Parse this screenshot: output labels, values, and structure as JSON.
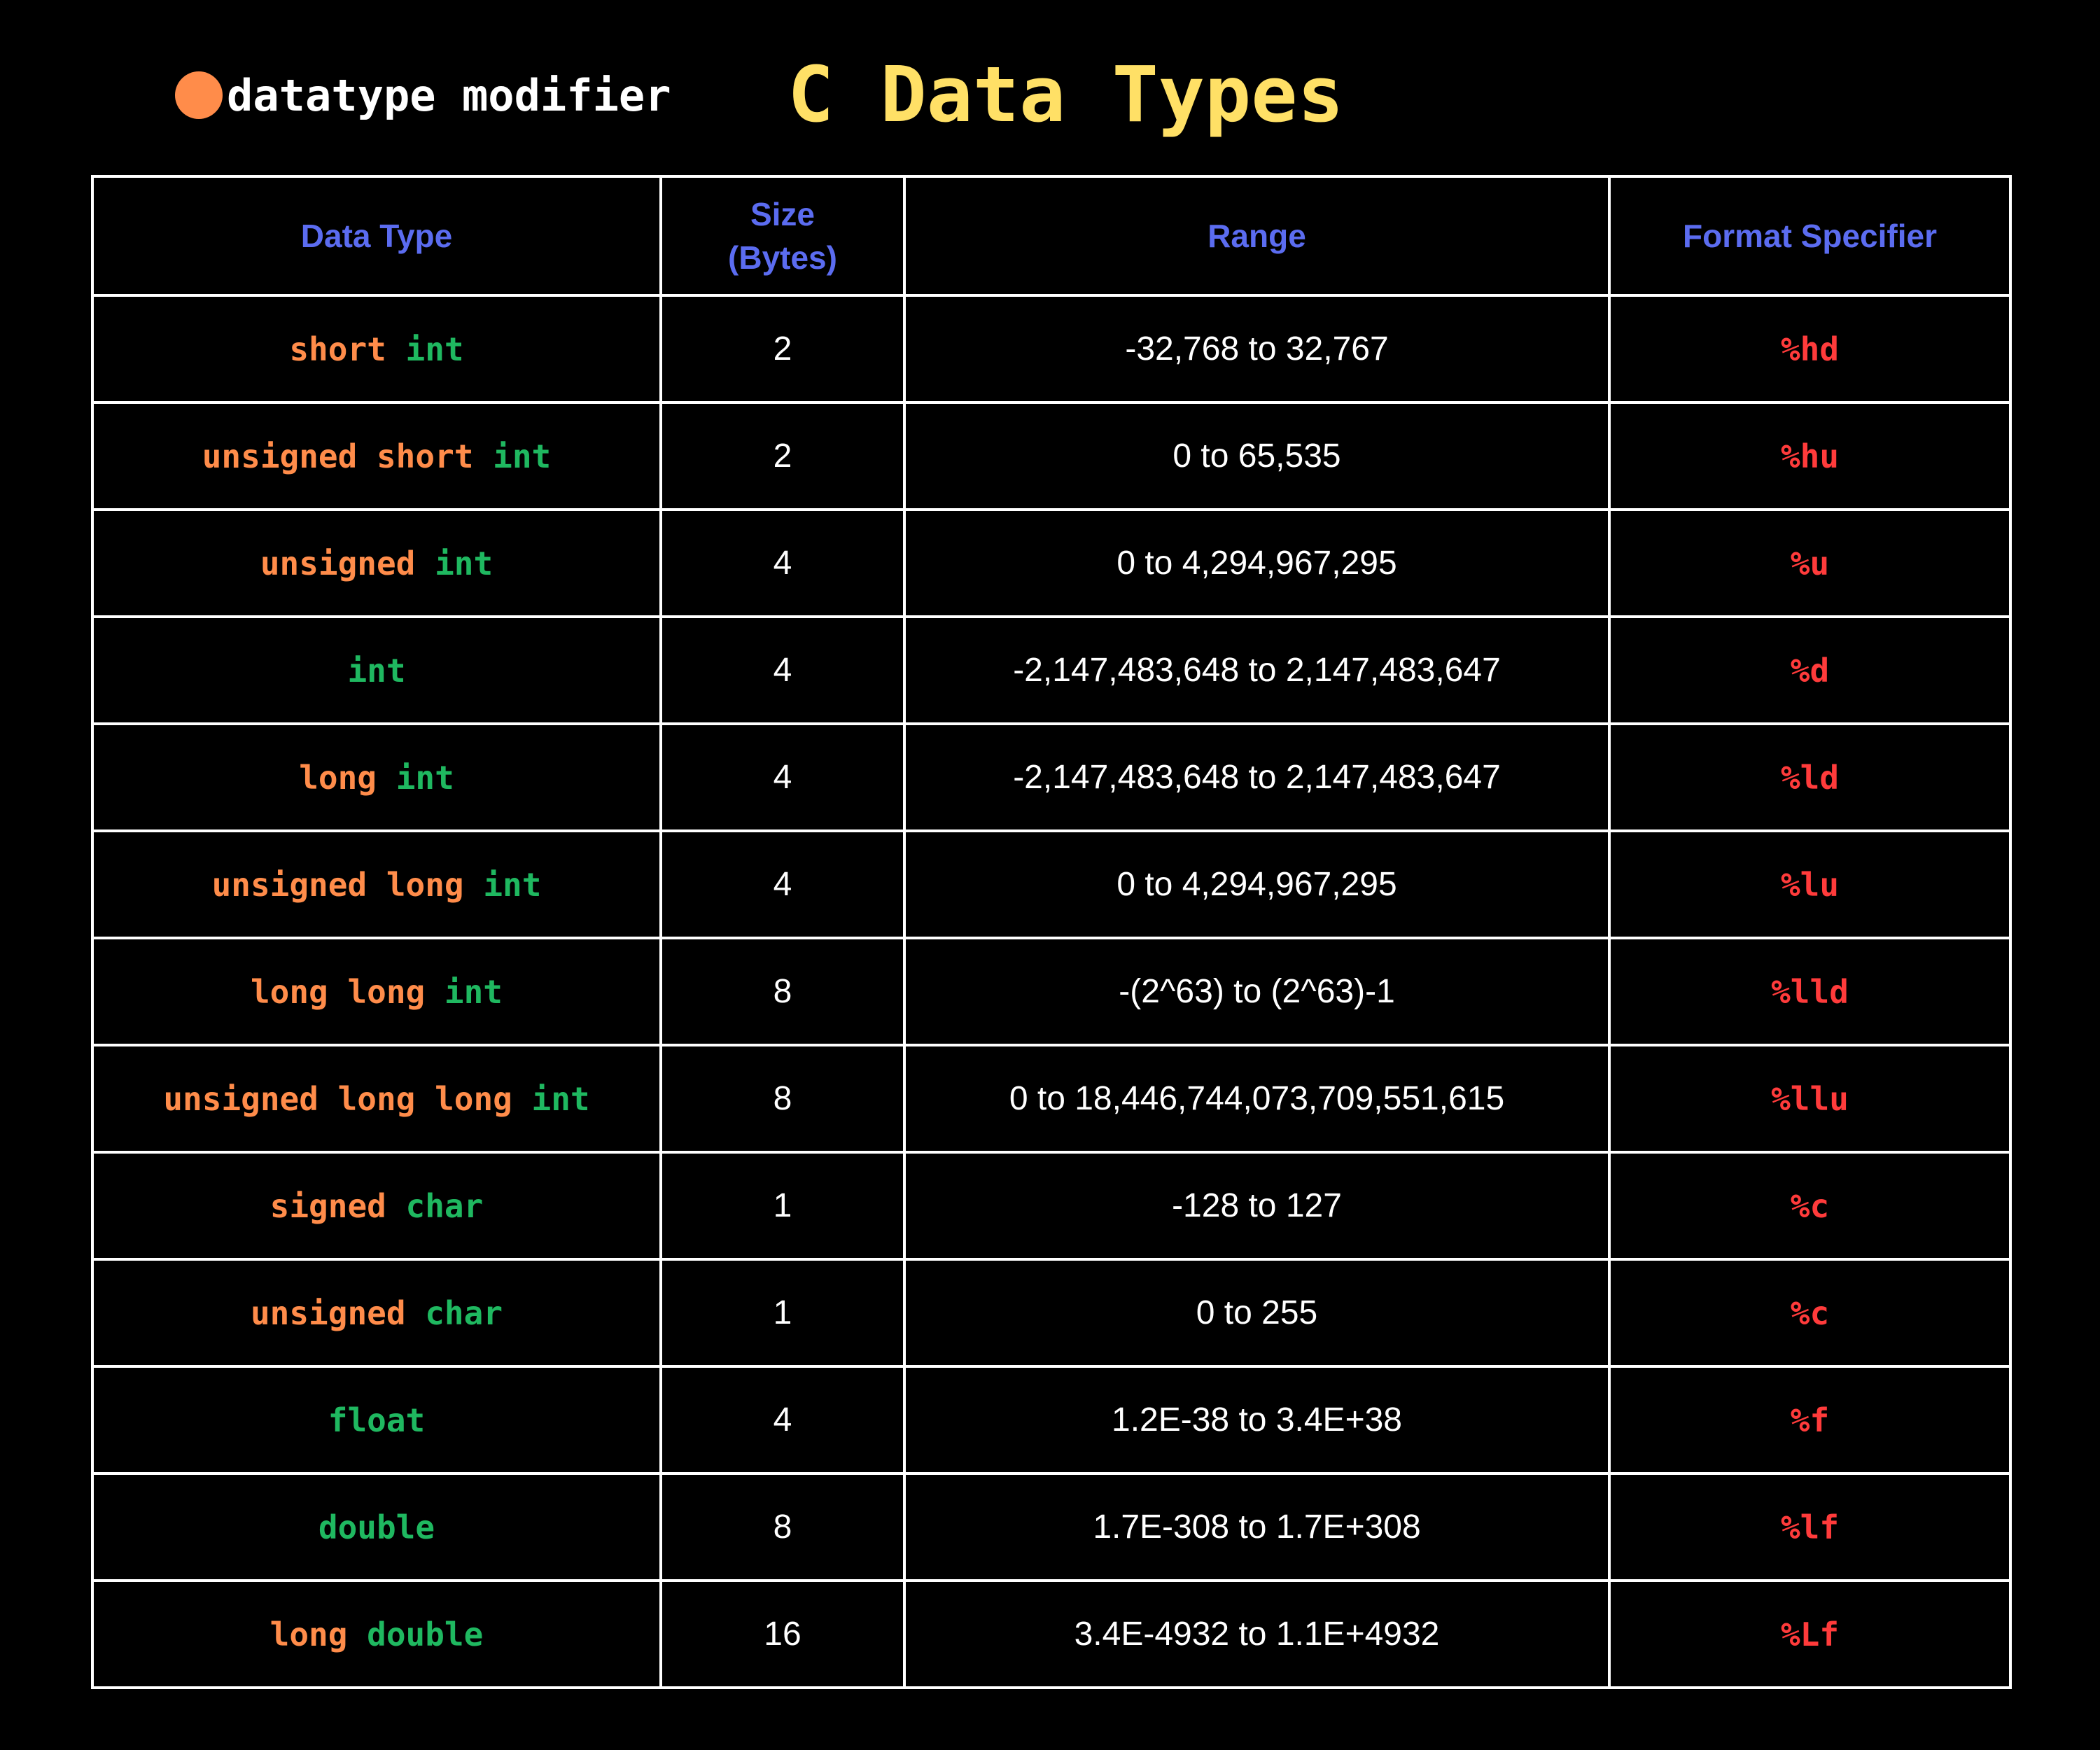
{
  "legend": {
    "text": "datatype modifier",
    "dot_color": "#FF8C4A"
  },
  "title": "C Data Types",
  "colors": {
    "background": "#000000",
    "title": "#FFE066",
    "header": "#5B6CF0",
    "modifier": "#FF8C4A",
    "datatype": "#1FB860",
    "format_specifier": "#FF3B3B",
    "text": "#FFFFFF"
  },
  "table": {
    "headers": {
      "data_type": "Data Type",
      "size_line1": "Size",
      "size_line2": "(Bytes)",
      "range": "Range",
      "format": "Format Specifier"
    },
    "rows": [
      {
        "modifiers": "short",
        "base": "int",
        "size": "2",
        "range": "-32,768 to 32,767",
        "format": "%hd"
      },
      {
        "modifiers": "unsigned short",
        "base": "int",
        "size": "2",
        "range": "0 to 65,535",
        "format": "%hu"
      },
      {
        "modifiers": "unsigned",
        "base": "int",
        "size": "4",
        "range": "0 to 4,294,967,295",
        "format": "%u"
      },
      {
        "modifiers": "",
        "base": "int",
        "size": "4",
        "range": "-2,147,483,648 to 2,147,483,647",
        "format": "%d"
      },
      {
        "modifiers": "long",
        "base": "int",
        "size": "4",
        "range": "-2,147,483,648 to 2,147,483,647",
        "format": "%ld"
      },
      {
        "modifiers": "unsigned long",
        "base": "int",
        "size": "4",
        "range": "0 to 4,294,967,295",
        "format": "%lu"
      },
      {
        "modifiers": "long long",
        "base": "int",
        "size": "8",
        "range": "-(2^63) to (2^63)-1",
        "format": "%lld"
      },
      {
        "modifiers": "unsigned long long",
        "base": "int",
        "size": "8",
        "range": "0 to 18,446,744,073,709,551,615",
        "format": "%llu"
      },
      {
        "modifiers": "signed",
        "base": "char",
        "size": "1",
        "range": "-128 to 127",
        "format": "%c"
      },
      {
        "modifiers": "unsigned",
        "base": "char",
        "size": "1",
        "range": "0 to 255",
        "format": "%c"
      },
      {
        "modifiers": "",
        "base": "float",
        "size": "4",
        "range": "1.2E-38 to 3.4E+38",
        "format": "%f"
      },
      {
        "modifiers": "",
        "base": "double",
        "size": "8",
        "range": "1.7E-308 to 1.7E+308",
        "format": "%lf"
      },
      {
        "modifiers": "long",
        "base": "double",
        "size": "16",
        "range": "3.4E-4932 to 1.1E+4932",
        "format": "%Lf"
      }
    ]
  }
}
